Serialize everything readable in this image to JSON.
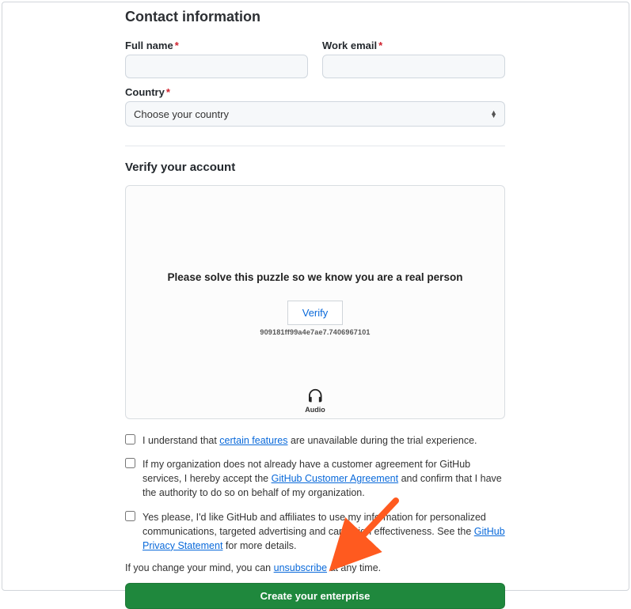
{
  "section": {
    "title": "Contact information",
    "fullname_label": "Full name",
    "workemail_label": "Work email",
    "country_label": "Country",
    "country_placeholder": "Choose your country",
    "required_mark": "*"
  },
  "verify": {
    "title": "Verify your account",
    "puzzle_text": "Please solve this puzzle so we know you are a real person",
    "verify_label": "Verify",
    "captcha_id": "909181ff99a4e7ae7.7406967101",
    "audio_label": "Audio"
  },
  "checks": {
    "c1_pre": "I understand that ",
    "c1_link": "certain features",
    "c1_post": " are unavailable during the trial experience.",
    "c2_pre": "If my organization does not already have a customer agreement for GitHub services, I hereby accept the ",
    "c2_link": "GitHub Customer Agreement",
    "c2_post": " and confirm that I have the authority to do so on behalf of my organization.",
    "c3_pre": "Yes please, I'd like GitHub and affiliates to use my information for personalized communications, targeted advertising and campaign effectiveness. See the ",
    "c3_link": "GitHub Privacy Statement",
    "c3_post": " for more details."
  },
  "unsubscribe": {
    "pre": "If you change your mind, you can ",
    "link": "unsubscribe",
    "post": " at any time."
  },
  "submit_label": "Create your enterprise"
}
